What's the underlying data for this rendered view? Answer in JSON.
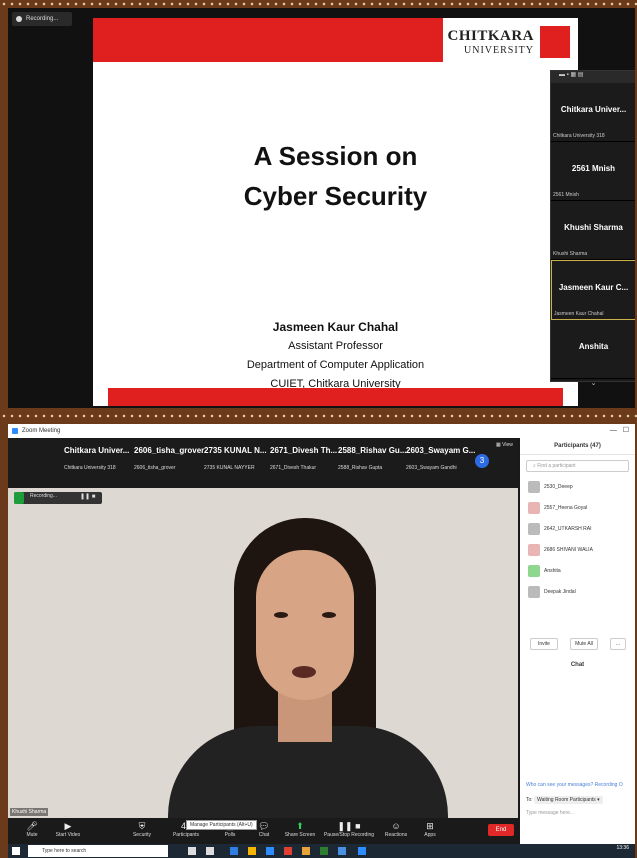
{
  "top_screen": {
    "recording": "Recording...",
    "slide": {
      "logo_name": "CHITKARA",
      "logo_sub": "UNIVERSITY",
      "title_line1": "A Session on",
      "title_line2": "Cyber Security",
      "presenter_name": "Jasmeen Kaur Chahal",
      "presenter_role": "Assistant Professor",
      "presenter_dept": "Department of Computer Application",
      "presenter_org": "CUIET, Chitkara University"
    },
    "panel_tiles": [
      {
        "name": "Chitkara Univer...",
        "sub": "Chitkara University 318"
      },
      {
        "name": "2561 Mnish",
        "sub": "2561 Mnish"
      },
      {
        "name": "Khushi Sharma",
        "sub": "Khushi Sharma"
      },
      {
        "name": "Jasmeen Kaur C...",
        "sub": "Jasmeen Kaur Chahal"
      },
      {
        "name": "Anshita",
        "sub": ""
      }
    ]
  },
  "zoom": {
    "window_title": "Zoom Meeting",
    "view_label": "View",
    "strip": [
      {
        "name": "Chitkara Univer...",
        "sub": "Chitkara University 318"
      },
      {
        "name": "2606_tisha_grover",
        "sub": "2606_tisha_grover"
      },
      {
        "name": "2735 KUNAL N...",
        "sub": "2735 KUNAL NAYYER"
      },
      {
        "name": "2671_Divesh Th...",
        "sub": "2671_Divesh Thakur"
      },
      {
        "name": "2588_Rishav Gu...",
        "sub": "2588_Rishav Gupta"
      },
      {
        "name": "2603_Swayam G...",
        "sub": "2603_Swayam Gandhi"
      }
    ],
    "strip_nav": "3",
    "video_recording": "Recording...",
    "speaker_label": "Khushi Sharma",
    "toolbar": {
      "mute": "Mute",
      "start_video": "Start Video",
      "security": "Security",
      "participants": "Participants",
      "participants_count": "47",
      "polls": "Polls",
      "chat": "Chat",
      "share_screen": "Share Screen",
      "pause_recording": "Pause/Stop Recording",
      "reactions": "Reactions",
      "apps": "Apps",
      "end": "End",
      "tooltip": "Manage Participants (Alt+U)"
    },
    "participants_panel": {
      "title": "Participants (47)",
      "search_placeholder": "Find a participant",
      "items": [
        "2530_Deeep",
        "2557_Heena Goyal",
        "2642_UTKARSH RAI",
        "2686 SHIVANI WALIA",
        "Anshita",
        "Deepak Jindal"
      ],
      "invite": "Invite",
      "mute_all": "Mute All",
      "more": "..."
    },
    "chat_panel": {
      "title": "Chat",
      "who_can_see": "Who can see your messages? Recording O",
      "to_label": "To:",
      "to_value": "Waiting Room Participants",
      "type_placeholder": "Type message here..."
    }
  },
  "taskbar": {
    "search_placeholder": "Type here to search",
    "time": "13:36"
  },
  "colors": {
    "brand_red": "#e0201f",
    "zoom_blue": "#2d6be4",
    "end_red": "#e02828"
  }
}
